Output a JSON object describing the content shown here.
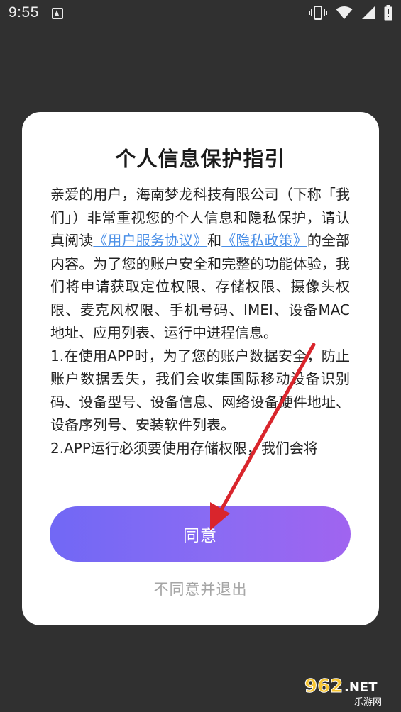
{
  "status_bar": {
    "time": "9:55",
    "icons": [
      "notification-a-icon",
      "vibrate-icon",
      "wifi-icon",
      "signal-icon",
      "battery-icon"
    ]
  },
  "dialog": {
    "title": "个人信息保护指引",
    "body": {
      "p1_part1": "亲爱的用户，海南梦龙科技有限公司（下称「我们」）非常重视您的个人信息和隐私保护，请认真阅读",
      "link_user_agreement": "《用户服务协议》",
      "p1_and": "和",
      "link_privacy_policy": "《隐私政策》",
      "p1_part2": "的全部内容。为了您的账户安全和完整的功能体验，我们将申请获取定位权限、存储权限、摄像头权限、麦克风权限、手机号码、IMEI、设备MAC地址、应用列表、运行中进程信息。",
      "p2": "1.在使用APP时，为了您的账户数据安全，防止账户数据丢失，我们会收集国际移动设备识别码、设备型号、设备信息、网络设备硬件地址、设备序列号、安装软件列表。",
      "p3": "2.APP运行必须要使用存储权限，我们会将"
    },
    "agree_label": "同意",
    "disagree_label": "不同意并退出"
  },
  "colors": {
    "overlay": "#303030",
    "link": "#4a8fe7",
    "button_gradient_start": "#7168f5",
    "button_gradient_end": "#a064f0",
    "arrow": "#d9252c"
  },
  "watermark": {
    "brand": "962.NET",
    "subtitle": "乐游网"
  }
}
